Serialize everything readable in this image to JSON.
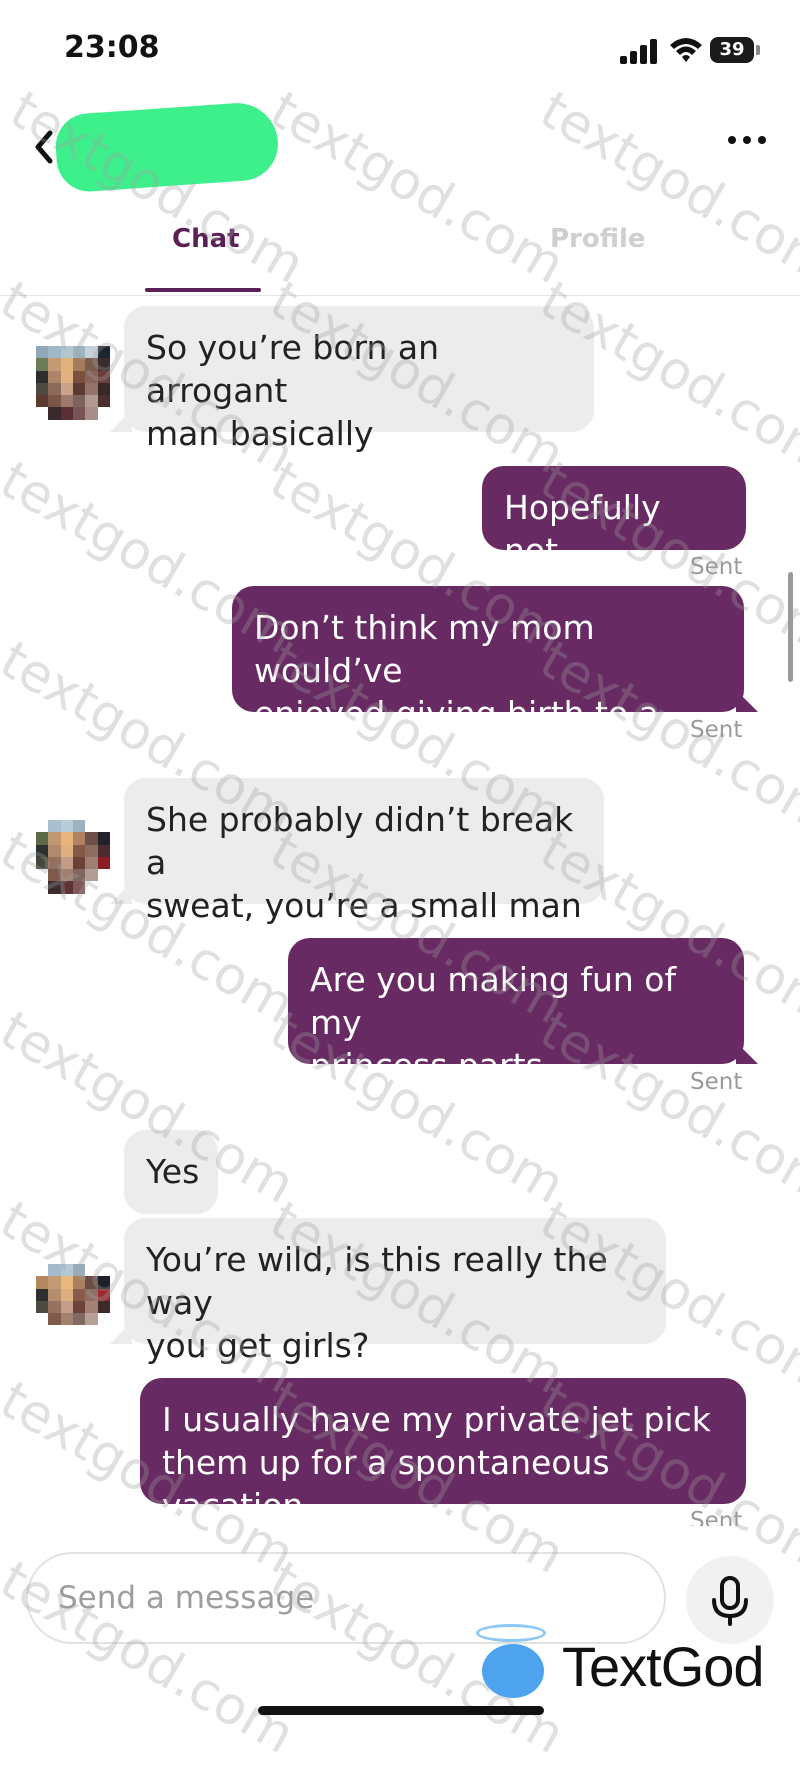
{
  "status_bar": {
    "time": "23:08",
    "battery": "39"
  },
  "header": {
    "tabs": [
      {
        "label": "Chat"
      },
      {
        "label": "Profile"
      }
    ]
  },
  "messages": [
    {
      "dir": "in",
      "lines": [
        "So you’re born an arrogant",
        "man basically"
      ]
    },
    {
      "dir": "out",
      "lines": [
        "Hopefully not"
      ],
      "status": "Sent"
    },
    {
      "dir": "out",
      "lines": [
        "Don’t think my mom would’ve",
        "enjoyed giving birth to a man"
      ],
      "status": "Sent"
    },
    {
      "dir": "in",
      "lines": [
        "She probably didn’t break a",
        "sweat, you’re a small man"
      ]
    },
    {
      "dir": "out",
      "lines": [
        "Are you making fun of my",
        "princess parts"
      ],
      "status": "Sent"
    },
    {
      "dir": "in",
      "lines": [
        "Yes"
      ]
    },
    {
      "dir": "in",
      "lines": [
        "You’re wild, is this really the way",
        "you get girls?"
      ]
    },
    {
      "dir": "out",
      "lines": [
        "I usually have my private jet pick",
        "them up for a spontaneous vacation"
      ],
      "status": "Sent"
    }
  ],
  "composer": {
    "placeholder": "Send a message"
  },
  "watermark": {
    "text": "textgod.com"
  },
  "branding": {
    "logo_text": "TextGod"
  },
  "colors": {
    "accent": "#5a1f56",
    "outgoing_bubble": "#682a63",
    "incoming_bubble": "#ececec",
    "name_blob": "#3df08c"
  }
}
